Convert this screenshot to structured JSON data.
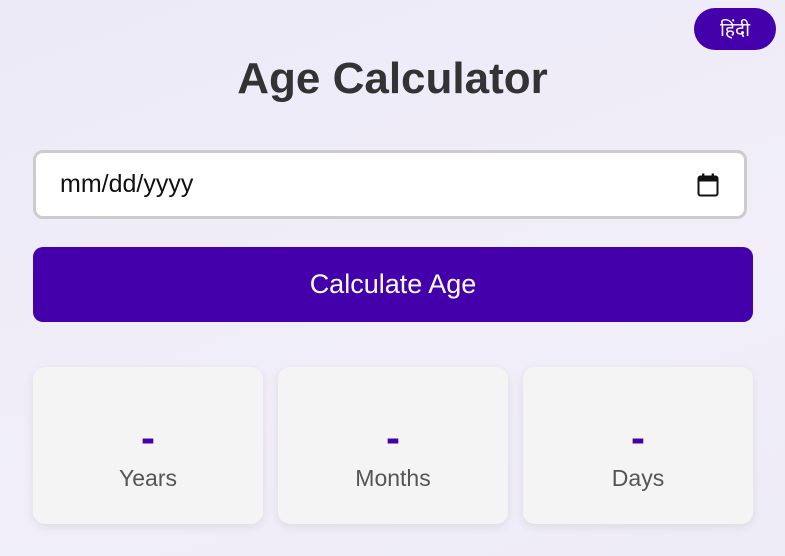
{
  "language_toggle": {
    "label": "हिंदी"
  },
  "title": "Age Calculator",
  "date_input": {
    "placeholder": "mm/dd/yyyy",
    "icon": "calendar-icon"
  },
  "calculate_button": {
    "label": "Calculate Age"
  },
  "results": [
    {
      "value": "-",
      "label": "Years"
    },
    {
      "value": "-",
      "label": "Months"
    },
    {
      "value": "-",
      "label": "Days"
    }
  ],
  "colors": {
    "accent": "#4400aa",
    "card_background": "#f4f4f4",
    "title_text": "#333333",
    "label_text": "#555555"
  }
}
